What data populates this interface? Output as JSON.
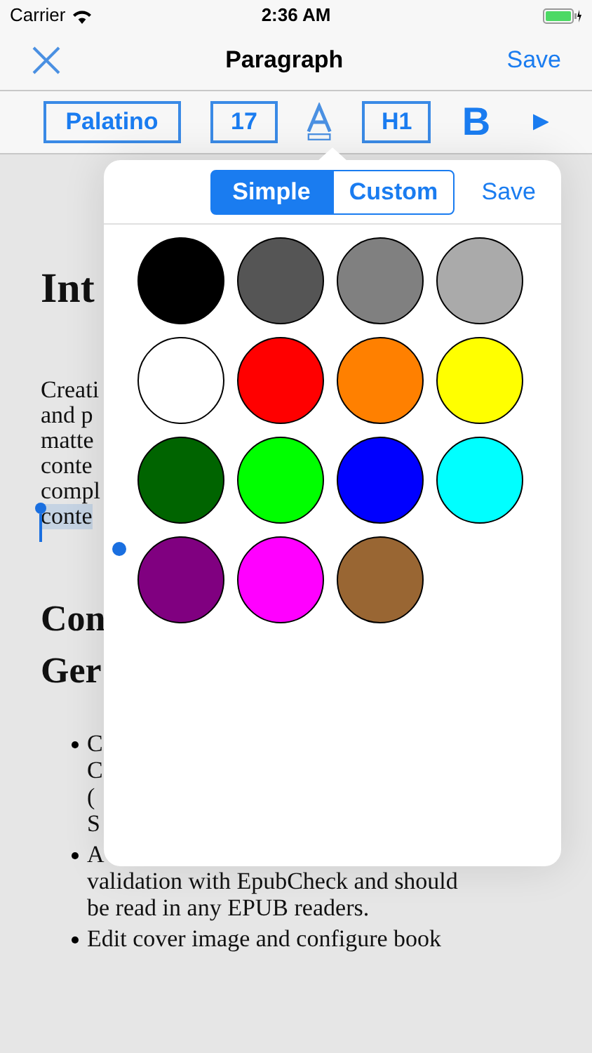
{
  "status_bar": {
    "carrier": "Carrier",
    "time": "2:36 AM"
  },
  "nav": {
    "title": "Paragraph",
    "save": "Save"
  },
  "toolbar": {
    "font": "Palatino",
    "size": "17",
    "heading": "H1",
    "bold": "B"
  },
  "document": {
    "heading": "Int",
    "paragraph_lines": [
      {
        "text": "Creati",
        "selected": false
      },
      {
        "text": "and p",
        "selected": false
      },
      {
        "text": "matte",
        "selected": false
      },
      {
        "text": "conte",
        "selected": false
      },
      {
        "text": "compl",
        "selected": false
      },
      {
        "text": "conte",
        "selected": true
      }
    ],
    "subheading_lines": [
      "Con",
      "Ger"
    ],
    "bullets": [
      {
        "lines": [
          "C",
          "C",
          "(",
          "S"
        ]
      },
      {
        "lines": [
          "A",
          "validation with EpubCheck and should",
          "be read in any EPUB readers."
        ]
      },
      {
        "lines": [
          "Edit cover image and configure book"
        ]
      }
    ]
  },
  "popover": {
    "segments": [
      {
        "label": "Simple",
        "selected": true
      },
      {
        "label": "Custom",
        "selected": false
      }
    ],
    "save": "Save",
    "colors": [
      {
        "color": "#000000"
      },
      {
        "color": "#555555"
      },
      {
        "color": "#808080"
      },
      {
        "color": "#aaaaaa"
      },
      {
        "color": "#ffffff"
      },
      {
        "color": "#ff0000"
      },
      {
        "color": "#ff8000"
      },
      {
        "color": "#ffff00"
      },
      {
        "color": "#006400"
      },
      {
        "color": "#00ff00"
      },
      {
        "color": "#0000ff"
      },
      {
        "color": "#00ffff"
      },
      {
        "color": "#800080"
      },
      {
        "color": "#ff00ff"
      },
      {
        "color": "#996633"
      }
    ]
  }
}
